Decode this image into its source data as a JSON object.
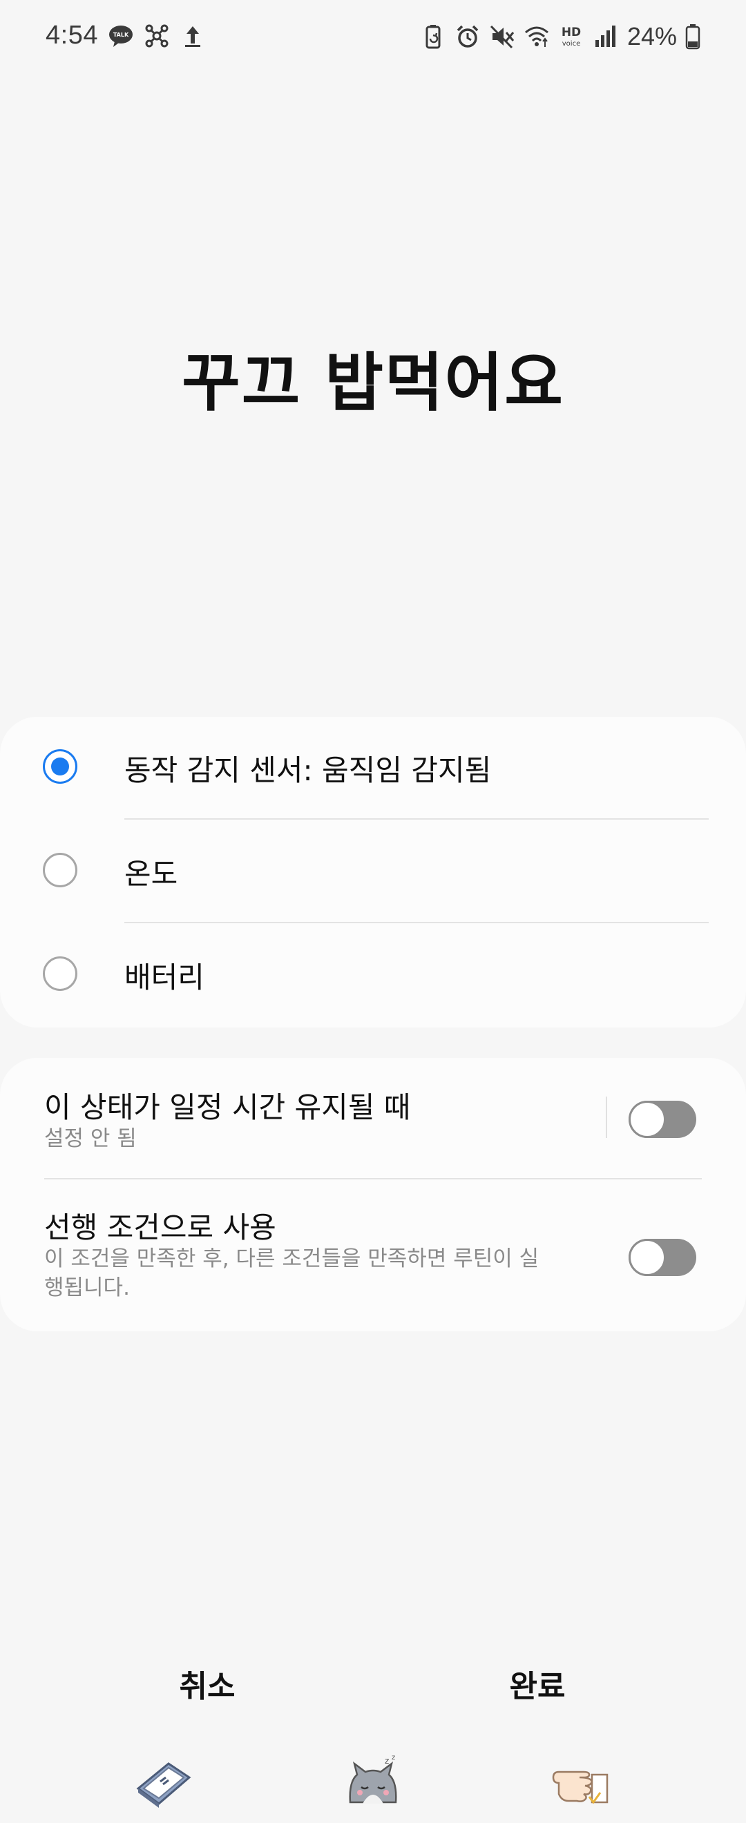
{
  "status_bar": {
    "time": "4:54",
    "battery": "24%",
    "hd_label": "HD",
    "voice_label": "voice",
    "talk_label": "TALK",
    "left_icons": [
      "kakaotalk-icon",
      "network-icon",
      "upload-icon"
    ],
    "right_icons": [
      "battery-saver-icon",
      "alarm-icon",
      "mute-icon",
      "wifi-icon",
      "hd-voice-icon",
      "signal-icon",
      "battery-icon"
    ]
  },
  "page": {
    "title": "꾸끄 밥먹어요"
  },
  "condition_options": [
    {
      "label": "동작 감지 센서: 움직임 감지됨",
      "selected": true
    },
    {
      "label": "온도",
      "selected": false
    },
    {
      "label": "배터리",
      "selected": false
    }
  ],
  "settings": {
    "duration": {
      "title": "이 상태가 일정 시간 유지될 때",
      "subtitle": "설정 안 됨",
      "enabled": false
    },
    "precondition": {
      "title": "선행 조건으로 사용",
      "subtitle": "이 조건을 만족한 후, 다른 조건들을 만족하면 루틴이 실행됩니다.",
      "enabled": false
    }
  },
  "actions": {
    "cancel_label": "취소",
    "done_label": "완료"
  },
  "nav_bar": {
    "icons": [
      "book-icon",
      "sleeping-cat-icon",
      "pointing-hand-icon"
    ]
  },
  "colors": {
    "accent": "#1a7bf0",
    "background": "#f6f6f6",
    "card": "#fcfcfc",
    "switch_off": "#8d8d8d"
  }
}
